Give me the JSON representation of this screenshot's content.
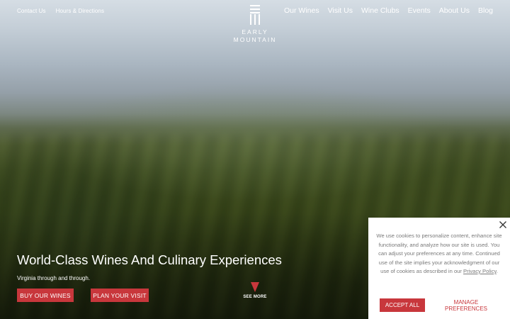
{
  "header": {
    "utility_links": [
      {
        "label": "Contact Us"
      },
      {
        "label": "Hours & Directions"
      }
    ],
    "nav": [
      {
        "label": "Our Wines"
      },
      {
        "label": "Visit Us"
      },
      {
        "label": "Wine Clubs"
      },
      {
        "label": "Events"
      },
      {
        "label": "About Us"
      },
      {
        "label": "Blog"
      }
    ],
    "logo": {
      "line1": "EARLY",
      "line2": "MOUNTAIN"
    }
  },
  "hero": {
    "title": "World-Class Wines And Culinary Experiences",
    "subtitle": "Virginia through and through.",
    "buy_button": "BUY OUR WINES",
    "visit_button": "PLAN YOUR VISIT",
    "see_more": "SEE MORE",
    "see_more_icon": "down-triangle-icon"
  },
  "cookie_banner": {
    "text_before_link": "We use cookies to personalize content, enhance site functionality, and analyze how our site is used. You can adjust your preferences at any time. Continued use of the site implies your acknowledgment of our use of cookies as described in our ",
    "link_label": "Privacy Policy",
    "text_after_link": ".",
    "accept_label": "ACCEPT ALL",
    "manage_label": "MANAGE PREFERENCES",
    "close_icon": "close-icon"
  },
  "colors": {
    "accent": "#c8373c",
    "banner_bg": "#ffffff",
    "banner_text": "#7a7a7a"
  }
}
